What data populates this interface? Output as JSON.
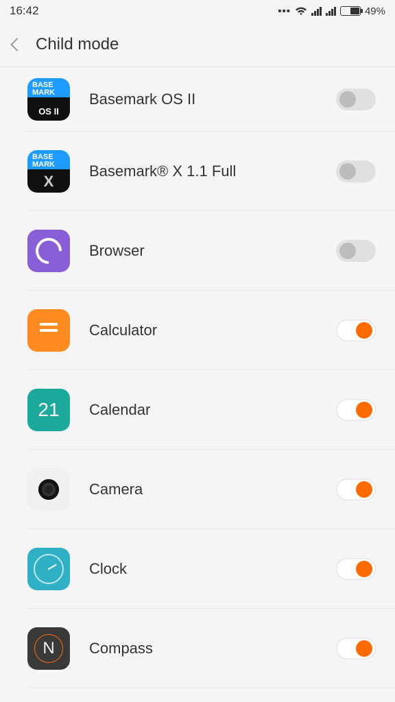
{
  "status": {
    "time": "16:42",
    "battery_pct": "49%"
  },
  "header": {
    "title": "Child mode"
  },
  "apps": [
    {
      "name": "Basemark OS II",
      "enabled": false,
      "icon": "basemarkos"
    },
    {
      "name": "Basemark® X 1.1 Full",
      "enabled": false,
      "icon": "basemarkx"
    },
    {
      "name": "Browser",
      "enabled": false,
      "icon": "browser"
    },
    {
      "name": "Calculator",
      "enabled": true,
      "icon": "calculator"
    },
    {
      "name": "Calendar",
      "enabled": true,
      "icon": "calendar",
      "badge": "21"
    },
    {
      "name": "Camera",
      "enabled": true,
      "icon": "camera"
    },
    {
      "name": "Clock",
      "enabled": true,
      "icon": "clock"
    },
    {
      "name": "Compass",
      "enabled": true,
      "icon": "compass"
    }
  ]
}
